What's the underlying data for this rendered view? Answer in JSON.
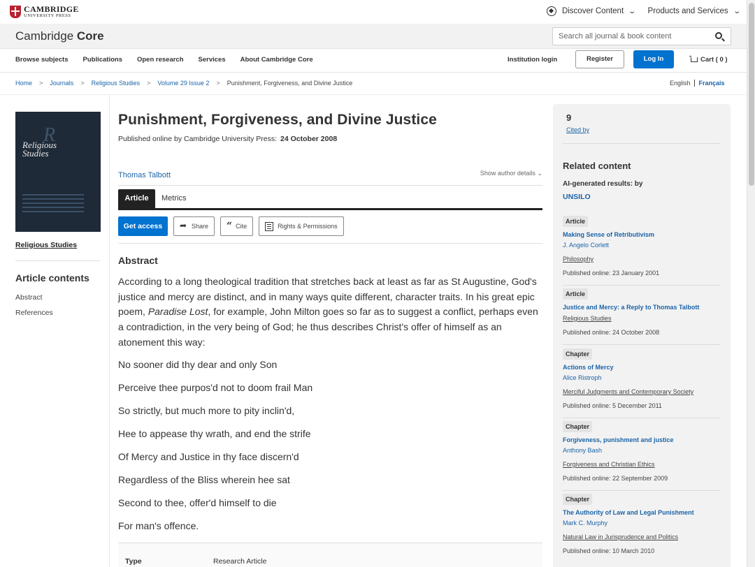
{
  "topbar": {
    "publisher_line1": "CAMBRIDGE",
    "publisher_line2": "UNIVERSITY PRESS",
    "discover_label": "Discover Content",
    "products_label": "Products and Services"
  },
  "header": {
    "brand_light": "Cambridge ",
    "brand_bold": "Core",
    "search_placeholder": "Search all journal & book content"
  },
  "nav": {
    "links": [
      "Browse subjects",
      "Publications",
      "Open research",
      "Services",
      "About Cambridge Core"
    ],
    "institution_login": "Institution login",
    "register": "Register",
    "login": "Log In",
    "cart": "Cart ( 0 )"
  },
  "breadcrumb": {
    "items": [
      "Home",
      "Journals",
      "Religious Studies",
      "Volume 29 Issue 2"
    ],
    "current": "Punishment, Forgiveness, and Divine Justice",
    "lang_en": "English",
    "lang_fr": "Français"
  },
  "sidebar": {
    "cover_title_line1": "Religious",
    "cover_title_line2": "Studies",
    "journal_link": "Religious Studies",
    "contents_heading": "Article contents",
    "contents_items": [
      "Abstract",
      "References"
    ]
  },
  "article": {
    "title": "Punishment, Forgiveness, and Divine Justice",
    "published_prefix": "Published online by Cambridge University Press:",
    "published_date": "24 October 2008",
    "author": "Thomas Talbott",
    "show_author_details": "Show author details",
    "tabs": [
      "Article",
      "Metrics"
    ],
    "actions": {
      "get_access": "Get access",
      "share": "Share",
      "cite": "Cite",
      "rights": "Rights & Permissions"
    },
    "abstract_heading": "Abstract",
    "abstract_before_italic": "According to a long theological tradition that stretches back at least as far as St Augustine, God's justice and mercy are distinct, and in many ways quite different, character traits. In his great epic poem, ",
    "abstract_italic": "Paradise Lost",
    "abstract_after_italic": ", for example, John Milton goes so far as to suggest a conflict, perhaps even a contradiction, in the very being of God; he thus describes Christ's offer of himself as an atonement this way:",
    "poem_lines": [
      "No sooner did thy dear and only Son",
      "Perceive thee purpos'd not to doom frail Man",
      "So strictly, but much more to pity inclin'd,",
      "Hee to appease thy wrath, and end the strife",
      "Of Mercy and Justice in thy face discern'd",
      "Regardless of the Bliss wherein hee sat",
      "Second to thee, offer'd himself to die",
      "For man's offence."
    ],
    "meta_type_label": "Type",
    "meta_type_value": "Research Article"
  },
  "rightpanel": {
    "cited_count": "9",
    "cited_label": "Cited by",
    "related_heading": "Related content",
    "ai_label": "AI-generated results: by",
    "unsilo": "UNSILO",
    "items": [
      {
        "type": "Article",
        "title": "Making Sense of Retributivism",
        "author": "J. Angelo Corlett",
        "source": "Philosophy",
        "date": "Published online: 23 January 2001"
      },
      {
        "type": "Article",
        "title": "Justice and Mercy: a Reply to Thomas Talbott",
        "author": "",
        "source": "Religious Studies",
        "date": "Published online: 24 October 2008"
      },
      {
        "type": "Chapter",
        "title": "Actions of Mercy",
        "author": "Alice Ristroph",
        "source": "Merciful Judgments and Contemporary Society",
        "date": "Published online: 5 December 2011"
      },
      {
        "type": "Chapter",
        "title": "Forgiveness, punishment and justice",
        "author": "Anthony Bash",
        "source": "Forgiveness and Christian Ethics",
        "date": "Published online: 22 September 2009"
      },
      {
        "type": "Chapter",
        "title": "The Authority of Law and Legal Punishment",
        "author": "Mark C. Murphy",
        "source": "Natural Law in Jurisprudence and Politics",
        "date": "Published online: 10 March 2010"
      }
    ]
  },
  "colors": {
    "accent_blue": "#0072cf",
    "link_blue": "#1a64a8",
    "brand_red": "#b8232f"
  }
}
